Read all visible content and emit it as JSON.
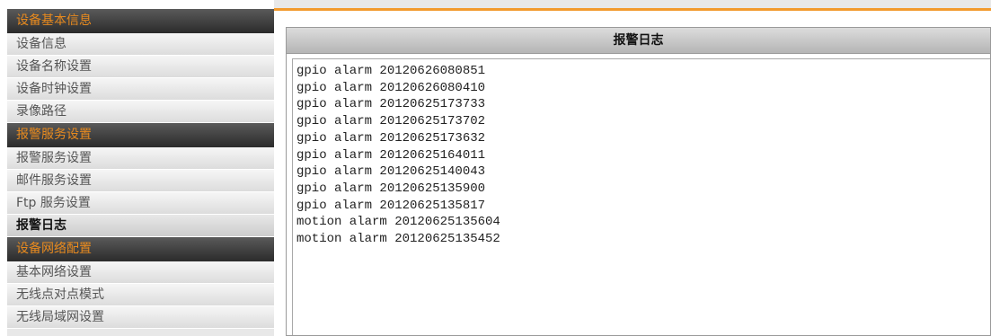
{
  "sidebar": {
    "sections": [
      {
        "header": "设备基本信息",
        "items": [
          {
            "label": "设备信息",
            "active": false
          },
          {
            "label": "设备名称设置",
            "active": false
          },
          {
            "label": "设备时钟设置",
            "active": false
          },
          {
            "label": "录像路径",
            "active": false
          }
        ]
      },
      {
        "header": "报警服务设置",
        "items": [
          {
            "label": "报警服务设置",
            "active": false
          },
          {
            "label": "邮件服务设置",
            "active": false
          },
          {
            "label": "Ftp 服务设置",
            "active": false
          },
          {
            "label": "报警日志",
            "active": true
          }
        ]
      },
      {
        "header": "设备网络配置",
        "items": [
          {
            "label": "基本网络设置",
            "active": false
          },
          {
            "label": "无线点对点模式",
            "active": false
          },
          {
            "label": "无线局域网设置",
            "active": false
          }
        ]
      }
    ]
  },
  "panel": {
    "title": "报警日志",
    "log_entries": [
      "gpio alarm 20120626080851",
      "gpio alarm 20120626080410",
      "gpio alarm 20120625173733",
      "gpio alarm 20120625173702",
      "gpio alarm 20120625173632",
      "gpio alarm 20120625164011",
      "gpio alarm 20120625140043",
      "gpio alarm 20120625135900",
      "gpio alarm 20120625135817",
      "motion alarm 20120625135604",
      "motion alarm 20120625135452"
    ]
  },
  "colors": {
    "accent_orange": "#f29a2e",
    "section_header_text": "#e88a1e",
    "section_header_bg": "#3a3a3a"
  }
}
